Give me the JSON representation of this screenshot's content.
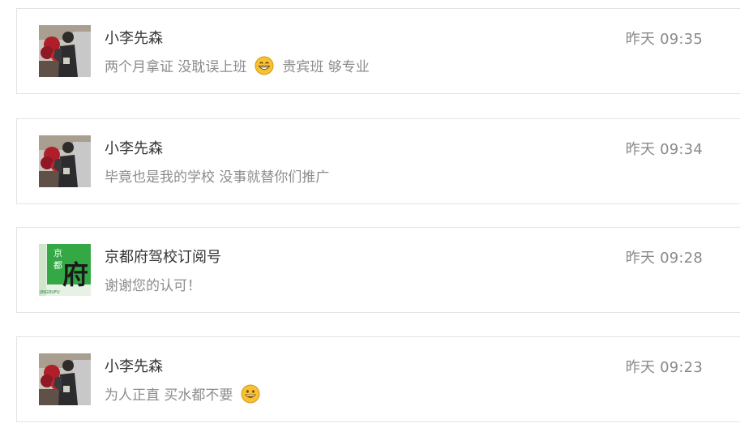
{
  "messages": [
    {
      "avatar": "user-photo",
      "name": "小李先森",
      "text_before_emoji": "两个月拿证 没耽误上班",
      "emoji": "grinning-face-with-teeth",
      "text_after_emoji": "贵宾班 够专业",
      "time": "昨天 09:35"
    },
    {
      "avatar": "user-photo",
      "name": "小李先森",
      "text_before_emoji": "毕竟也是我的学校 没事就替你们推广",
      "emoji": "",
      "text_after_emoji": "",
      "time": "昨天 09:34"
    },
    {
      "avatar": "school-logo",
      "name": "京都府驾校订阅号",
      "text_before_emoji": "谢谢您的认可！",
      "emoji": "",
      "text_after_emoji": "",
      "time": "昨天 09:28",
      "logo_text": {
        "top": "京",
        "middle": "都",
        "main": "府",
        "bottom": "JINGDUFU"
      }
    },
    {
      "avatar": "user-photo",
      "name": "小李先森",
      "text_before_emoji": "为人正直 买水都不要",
      "emoji": "smiling-face",
      "text_after_emoji": "",
      "time": "昨天 09:23"
    }
  ],
  "colors": {
    "name": "#333333",
    "message": "#8c8c8c",
    "time": "#8a8a8a",
    "card_border": "#e3e3e3",
    "logo_green": "#35a846"
  }
}
